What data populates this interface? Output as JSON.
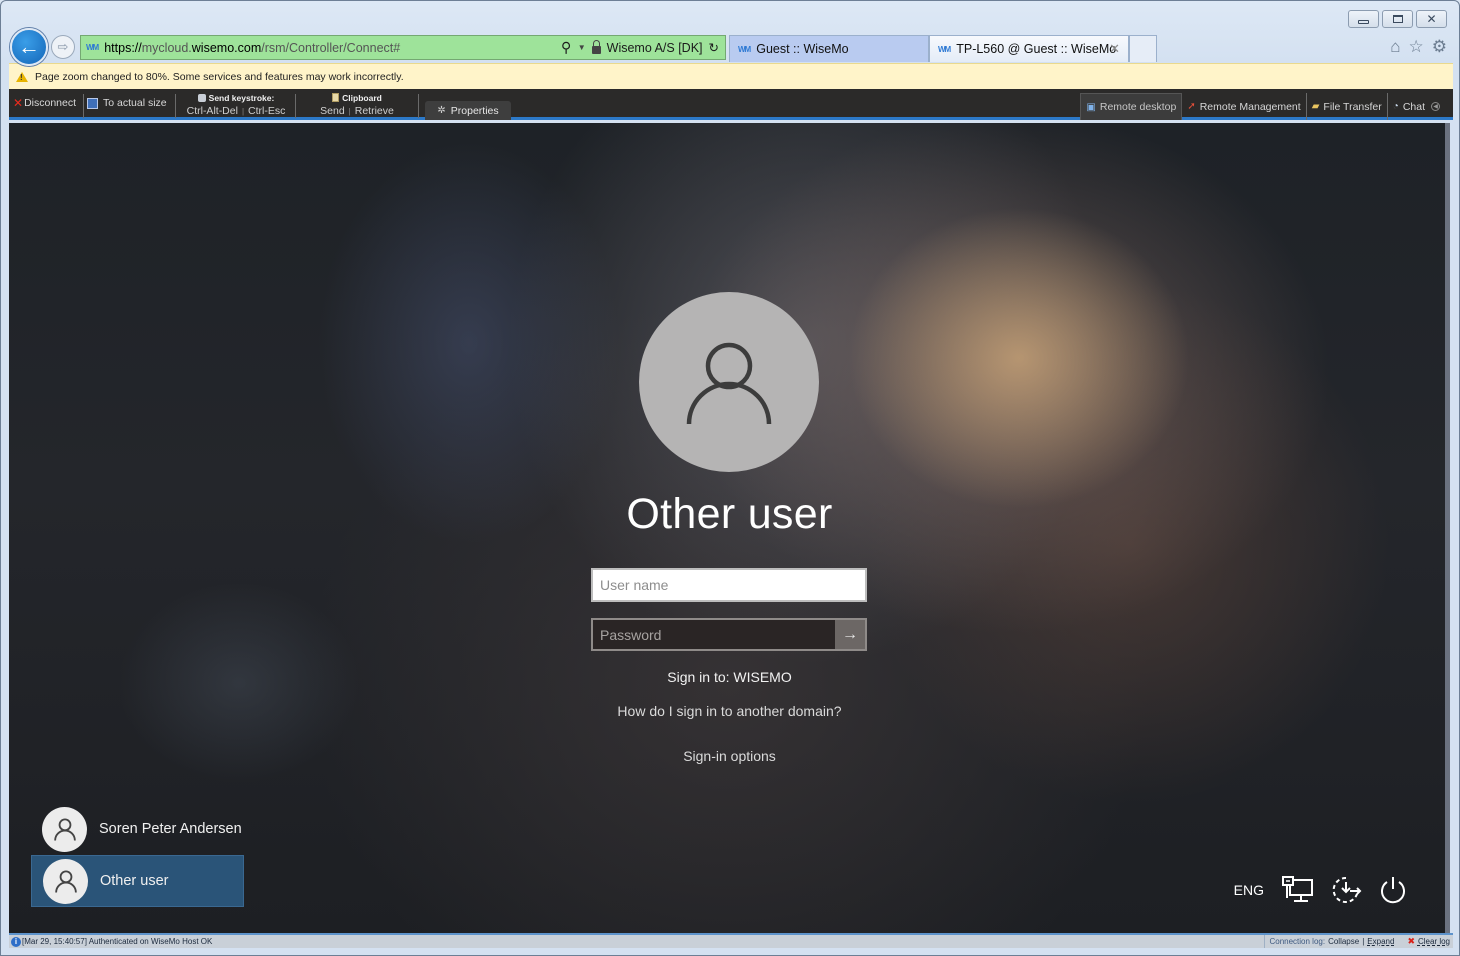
{
  "browser": {
    "address": {
      "protocol": "https://",
      "host_prefix": "mycloud.",
      "host_domain": "wisemo.com",
      "path": "/rsm/Controller/Connect#",
      "certificate_owner": "Wisemo A/S [DK]"
    },
    "tabs": [
      {
        "label": "Guest :: WiseMo",
        "active": false
      },
      {
        "label": "TP-L560 @ Guest :: WiseMo",
        "active": true,
        "close_glyph": "✕"
      }
    ],
    "icons": {
      "home": "⌂",
      "favorites": "☆",
      "settings": "⚙",
      "back": "←",
      "forward": "⇨",
      "search": "⚲",
      "refresh": "↻"
    },
    "window_controls": {
      "minimize": "minimize",
      "maximize": "maximize",
      "close": "✕"
    },
    "site_icon_text": "WM",
    "notification": "Page zoom changed to 80%. Some services and features may work incorrectly."
  },
  "toolbar": {
    "disconnect": "Disconnect",
    "actual_size": "To actual size",
    "send_keystroke": {
      "header": "Send keystroke:",
      "items": [
        "Ctrl-Alt-Del",
        "Ctrl-Esc"
      ]
    },
    "clipboard": {
      "header": "Clipboard",
      "items": [
        "Send",
        "Retrieve"
      ]
    },
    "properties": "Properties",
    "tabs": [
      {
        "label": "Remote desktop",
        "icon": "remote-desktop-icon",
        "active": true
      },
      {
        "label": "Remote Management",
        "icon": "remote-management-icon",
        "active": false
      },
      {
        "label": "File Transfer",
        "icon": "file-transfer-icon",
        "active": false
      },
      {
        "label": "Chat",
        "icon": "chat-icon",
        "active": false
      }
    ]
  },
  "login": {
    "title": "Other user",
    "username_placeholder": "User name",
    "username_value": "",
    "password_placeholder": "Password",
    "password_value": "",
    "sign_in_to": "Sign in to: WISEMO",
    "domain_help": "How do I sign in to another domain?",
    "sign_in_options": "Sign-in options",
    "users": [
      {
        "name": "Soren Peter Andersen",
        "selected": false
      },
      {
        "name": "Other user",
        "selected": true
      }
    ],
    "language": "ENG",
    "colors": {
      "selected_user": "#2a5478"
    }
  },
  "status": {
    "message": "[Mar 29, 15:40:57] Authenticated on WiseMo Host OK",
    "log_label": "Connection log:",
    "collapse": "Collapse",
    "separator": "|",
    "expand": "Expand",
    "clear_log": "Clear log"
  }
}
